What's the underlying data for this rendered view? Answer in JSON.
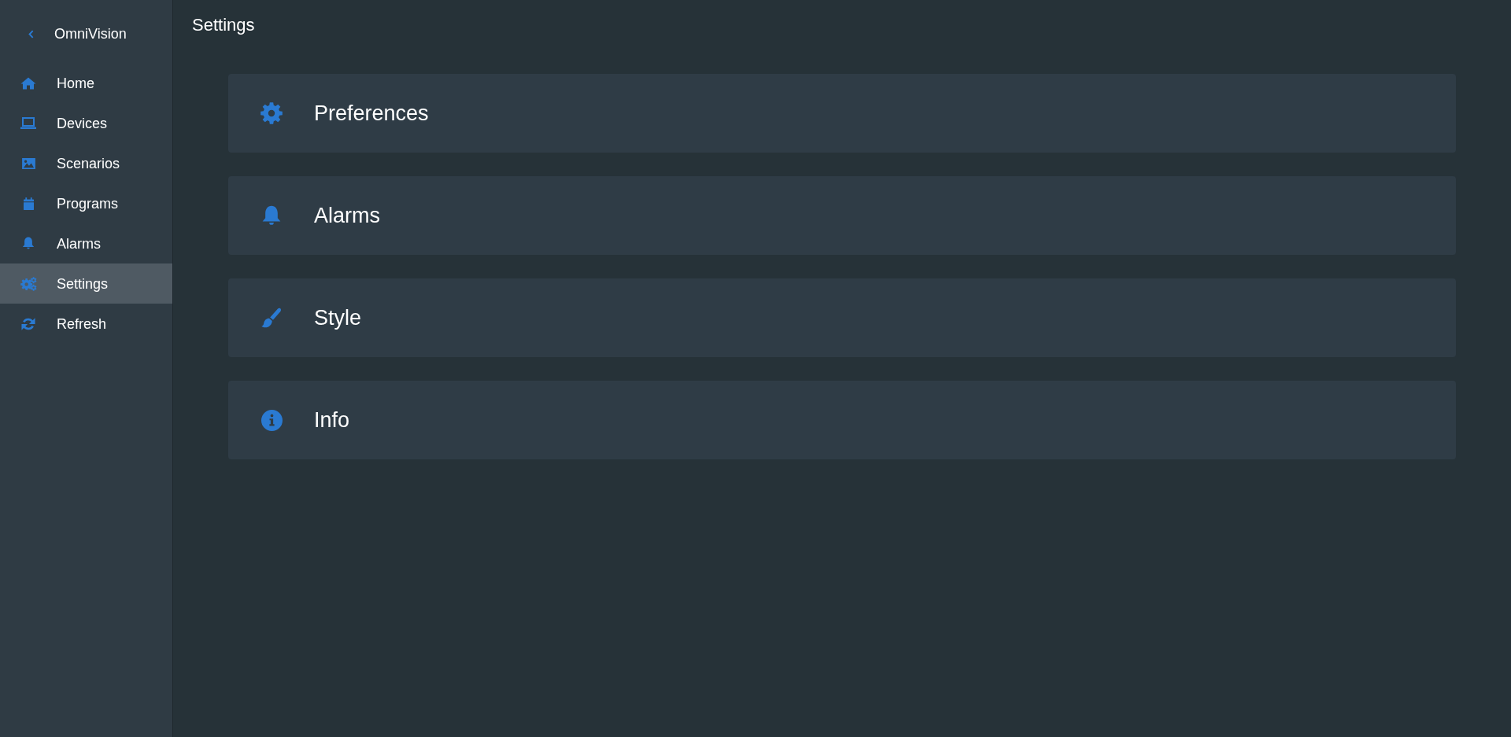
{
  "sidebar": {
    "title": "OmniVision",
    "items": [
      {
        "label": "Home",
        "selected": false
      },
      {
        "label": "Devices",
        "selected": false
      },
      {
        "label": "Scenarios",
        "selected": false
      },
      {
        "label": "Programs",
        "selected": false
      },
      {
        "label": "Alarms",
        "selected": false
      },
      {
        "label": "Settings",
        "selected": true
      },
      {
        "label": "Refresh",
        "selected": false
      }
    ]
  },
  "page": {
    "title": "Settings"
  },
  "cards": [
    {
      "label": "Preferences"
    },
    {
      "label": "Alarms"
    },
    {
      "label": "Style"
    },
    {
      "label": "Info"
    }
  ]
}
